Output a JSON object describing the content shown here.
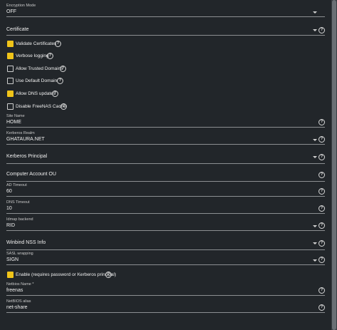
{
  "encryption_mode": {
    "label": "Encryption Mode",
    "value": "OFF"
  },
  "certificate": {
    "label": "Certificate"
  },
  "checkboxes": [
    {
      "label": "Validate Certificates",
      "checked": true
    },
    {
      "label": "Verbose logging",
      "checked": true
    },
    {
      "label": "Allow Trusted Domains",
      "checked": false
    },
    {
      "label": "Use Default Domain",
      "checked": false
    },
    {
      "label": "Allow DNS updates",
      "checked": true
    },
    {
      "label": "Disable FreeNAS Cache",
      "checked": false
    }
  ],
  "site_name": {
    "label": "Site Name",
    "value": "HOME"
  },
  "kerberos_realm": {
    "label": "Kerberos Realm",
    "value": "GHATAURA.NET"
  },
  "kerberos_principal": {
    "label": "Kerberos Principal"
  },
  "computer_account_ou": {
    "label": "Computer Account OU"
  },
  "ad_timeout": {
    "label": "AD Timeout",
    "value": "60"
  },
  "dns_timeout": {
    "label": "DNS Timeout",
    "value": "10"
  },
  "idmap_backend": {
    "label": "Idmap backend",
    "value": "RID"
  },
  "winbind_nss_info": {
    "label": "Winbind NSS Info"
  },
  "sasl_wrapping": {
    "label": "SASL wrapping",
    "value": "SIGN"
  },
  "enable": {
    "label": "Enable (requires password or Kerberos principal)",
    "checked": true
  },
  "netbios_name": {
    "label": "Netbios Name *",
    "value": "freenas"
  },
  "netbios_alias": {
    "label": "NetBIOS alias",
    "value": "net-share"
  },
  "icons": {
    "help": "help-circle-icon",
    "dropdown": "caret-down-icon"
  },
  "colors": {
    "accent": "#f0c419",
    "background": "#22262a"
  }
}
